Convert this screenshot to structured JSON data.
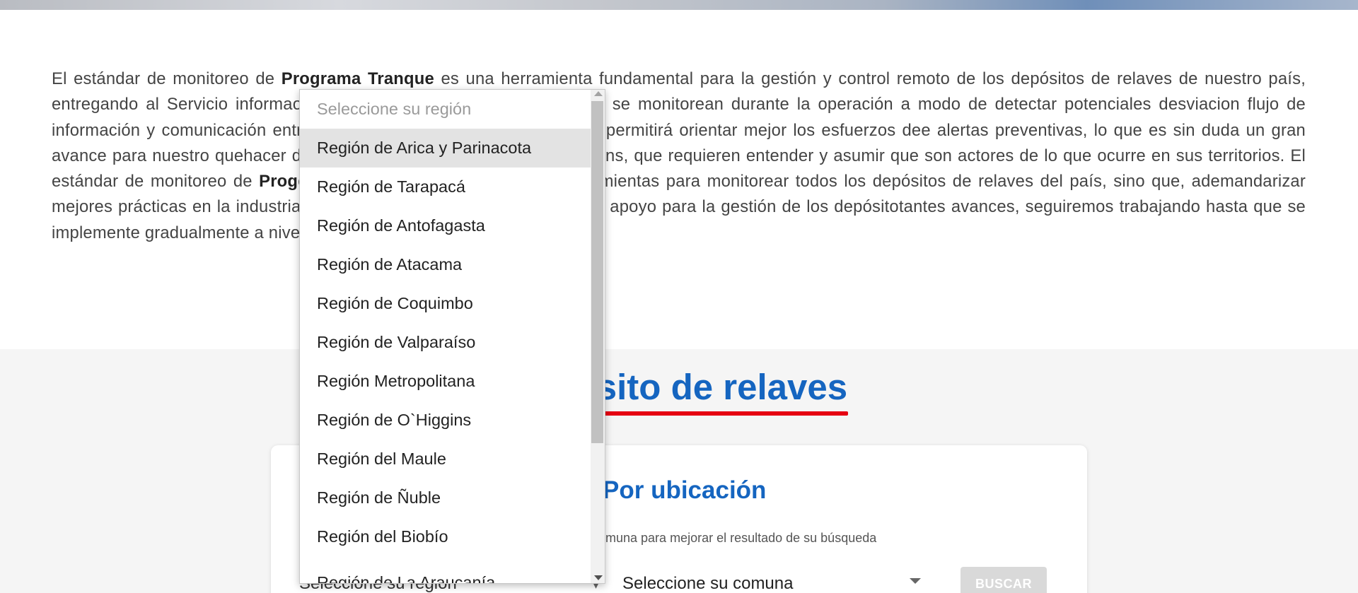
{
  "intro": {
    "p1": "El estándar de monitoreo de ",
    "b1": "Programa Tranque",
    "p2": " es una herramienta fundamental para la gestión y control remoto de los depósitos de relaves de nuestro país, entregando al Servicio informa",
    "p3": "omisos de cada depósito y cómo estos se monitorean durante la operación a modo de detectar potenciales desviacion",
    "p4": " flujo de información y comunicación entre el Servicio y las compañías mineras permitirá orientar mejor los esfuerzos de",
    "p5": "e alertas preventivas, lo que es sin duda un gran avance para nuestro quehacer diario. En esta misma línea, el sistema en",
    "p6": "s, que requieren entender y asumir que son actores de lo que ocurre en sus territorios. El estándar de monitoreo de ",
    "b2": "Prog",
    "p7": "ente porque define técnicamente herramientas para monitorear todos los depósitos de relaves del país, sino que, adem",
    "p8": "andarizar mejores prácticas en la industria minera chilena, convirtiéndose en gran apoyo para la gestión de los depósito",
    "p9": "tantes avances, seguiremos trabajando hasta que se implemente gradualmente a nivel nacional."
  },
  "section": {
    "title": "depósito de relaves"
  },
  "card": {
    "title": "Por ubicación",
    "help": "omuna para mejorar el resultado de su búsqueda"
  },
  "region_select": {
    "value": "Seleccione su región"
  },
  "comuna_select": {
    "value": "Seleccione su comuna"
  },
  "buscar_button": {
    "label": "BUSCAR"
  },
  "dropdown": {
    "placeholder": "Seleccione su región",
    "highlighted_index": 0,
    "options": [
      "Región de Arica y Parinacota",
      "Región de Tarapacá",
      "Región de Antofagasta",
      "Región de Atacama",
      "Región de Coquimbo",
      "Región de Valparaíso",
      "Región Metropolitana",
      "Región de O`Higgins",
      "Región del Maule",
      "Región de Ñuble",
      "Región del Biobío",
      "Región de La Araucanía"
    ]
  },
  "colors": {
    "brand_blue": "#1565c0",
    "accent_red": "#e60012",
    "button_disabled": "#d9d9d9",
    "highlight_row": "#e3e3e3"
  }
}
